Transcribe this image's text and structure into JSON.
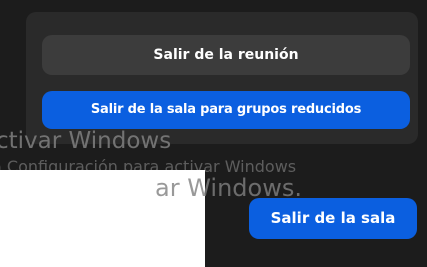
{
  "dialog": {
    "leave_meeting_label": "Salir de la reunión",
    "leave_breakout_rooms_label": "Salir de la sala para grupos reducidos"
  },
  "activation_watermark": {
    "title": "ctivar Windows",
    "subtitle": "a Configuración para activar Windows",
    "title_overlap": "ar Windows."
  },
  "footer": {
    "leave_room_label": "Salir de la sala"
  },
  "colors": {
    "background": "#1c1c1c",
    "popup": "#2a2a2a",
    "secondary_button": "#3c3c3c",
    "primary_button": "#0b5fe0",
    "watermark_text": "#808080"
  }
}
